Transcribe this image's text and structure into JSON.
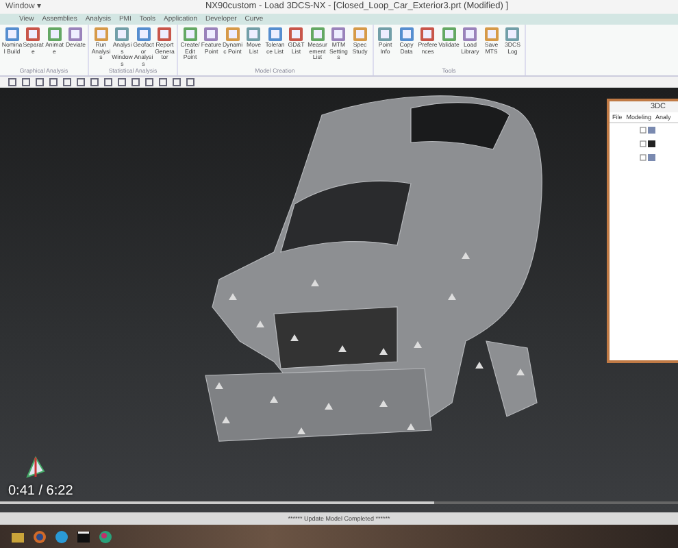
{
  "window": {
    "menu_label": "Window ▾",
    "title": "NX90custom - Load 3DCS-NX - [Closed_Loop_Car_Exterior3.prt (Modified) ]"
  },
  "menu": [
    "View",
    "Assemblies",
    "Analysis",
    "PMI",
    "Tools",
    "Application",
    "Developer",
    "Curve"
  ],
  "ribbon_groups": [
    {
      "name": "Graphical Analysis",
      "buttons": [
        "Nominal Build",
        "Separate",
        "Animate",
        "Deviate"
      ]
    },
    {
      "name": "Statistical Analysis",
      "buttons": [
        "Run Analysis",
        "Analysis Windows",
        "Geofactor Analysis",
        "Report Generator"
      ]
    },
    {
      "name": "Model Creation",
      "buttons": [
        "Create/Edit Point",
        "Feature Point",
        "Dynamic Point",
        "Move List",
        "Tolerance List",
        "GD&T List",
        "Measurement List",
        "MTM Settings",
        "Spec Study"
      ]
    },
    {
      "name": "Tools",
      "buttons": [
        "Point Info",
        "Copy Data",
        "Preferences",
        "Validate",
        "Load Library",
        "Save MTS",
        "3DCS Log"
      ]
    }
  ],
  "panel": {
    "title": "3DC",
    "menu": [
      "File",
      "Modeling",
      "Analy"
    ]
  },
  "status_bar": "****** Update Model Completed ******",
  "video": {
    "time": "0:41 / 6:22",
    "level": 0.64
  }
}
